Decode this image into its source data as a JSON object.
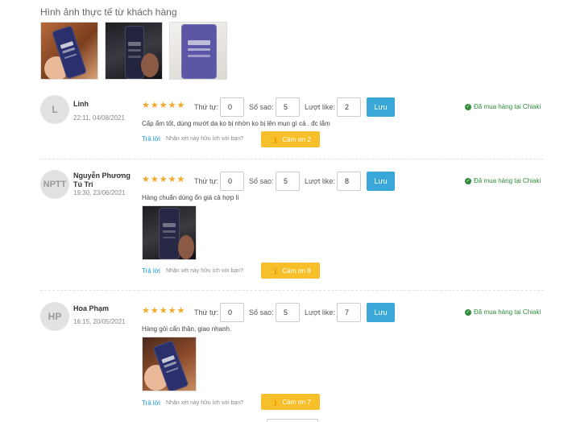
{
  "gallery": {
    "title": "Hình ảnh thực tế từ khách hàng"
  },
  "controls": {
    "order_label": "Thứ tự:",
    "stars_label": "Số sao:",
    "likes_label": "Lượt like:",
    "save_label": "Lưu"
  },
  "common": {
    "verified": "Đã mua hàng tại Chiaki",
    "reply": "Trả lời",
    "helpful": "Nhận xét này hữu ích với bạn?"
  },
  "reviews": [
    {
      "avatar": "L",
      "name": "Linh",
      "date": "22:11, 04/08/2021",
      "rating": 5,
      "order": "0",
      "stars": "5",
      "likes": "2",
      "content": "Cấp ẩm tốt, dùng mướt da ko bị nhờn ko bị lên mụn gì cả . đc lắm",
      "thanks": "Cảm ơn 2"
    },
    {
      "avatar": "NPTT",
      "name": "Nguyễn Phương Tú Trí",
      "date": "19:30, 23/06/2021",
      "rating": 5,
      "order": "0",
      "stars": "5",
      "likes": "8",
      "content": "Hàng chuẩn dùng ổn giá cả hợp lí",
      "thanks": "Cảm ơn 8"
    },
    {
      "avatar": "HP",
      "name": "Hoa Phạm",
      "date": "16:15, 20/05/2021",
      "rating": 5,
      "order": "0",
      "stars": "5",
      "likes": "7",
      "content": "Hàng gói cẩn thận, giao nhanh.",
      "thanks": "Cảm ơn 7"
    }
  ],
  "colors": {
    "accent": "#3aa7d9",
    "star": "#f5a623",
    "thanks": "#f7c02b",
    "verified": "#2e8b3a",
    "link": "#1a9ad6"
  }
}
